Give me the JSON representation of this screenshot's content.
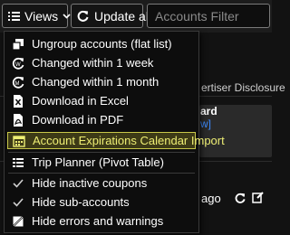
{
  "toolbar": {
    "views_label": "Views",
    "update_label": "Update all",
    "filter_placeholder": "Accounts Filter"
  },
  "background": {
    "advertiser_disclosure": "ertiser Disclosure",
    "card_fragment": "ard",
    "link_fragment": "w]",
    "row_time_fragment": "ago"
  },
  "menu": {
    "items": [
      {
        "label": "Ungroup accounts (flat list)",
        "icon": "ungroup-icon"
      },
      {
        "label": "Changed within 1 week",
        "icon": "refresh-week-icon"
      },
      {
        "label": "Changed within 1 month",
        "icon": "refresh-month-icon"
      },
      {
        "label": "Download in Excel",
        "icon": "excel-file-icon"
      },
      {
        "label": "Download in PDF",
        "icon": "pdf-file-icon"
      },
      {
        "label": "Account Expirations Calendar Import",
        "icon": "calendar-icon",
        "active": true
      },
      {
        "label": "Trip Planner (Pivot Table)",
        "icon": "pivot-table-icon"
      },
      {
        "label": "Hide inactive coupons",
        "icon": "check-icon"
      },
      {
        "label": "Hide sub-accounts",
        "icon": "check-icon"
      },
      {
        "label": "Hide errors and warnings",
        "icon": "errors-hidden-icon"
      }
    ]
  },
  "colors": {
    "highlight_bg": "#3d3a16",
    "highlight_border": "#c8c84a",
    "highlight_text": "#eeee74"
  }
}
